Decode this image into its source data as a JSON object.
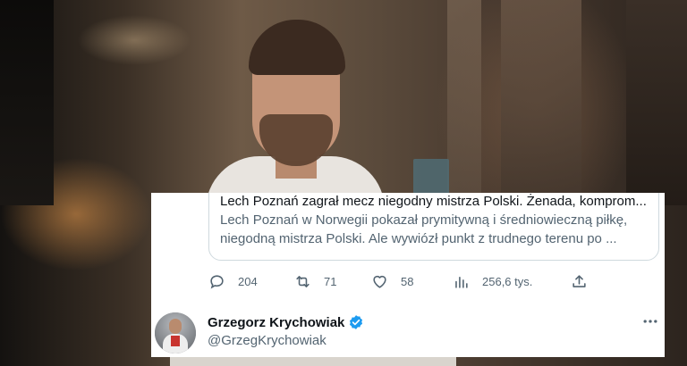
{
  "quoted_tweet": {
    "title": "Lech Poznań zagrał mecz niegodny mistrza Polski. Żenada, komprom...",
    "body_lines": [
      "Lech Poznań w Norwegii pokazał prymitywną i średniowieczną piłkę,",
      "niegodną mistrza Polski. Ale wywiózł punkt z trudnego terenu po ..."
    ]
  },
  "actions": {
    "replies": "204",
    "retweets": "71",
    "likes": "58",
    "views": "256,6 tys."
  },
  "author": {
    "name": "Grzegorz Krychowiak",
    "handle": "@GrzegKrychowiak",
    "verified": true
  },
  "colors": {
    "text_primary": "#0f1419",
    "text_secondary": "#536471",
    "verified_blue": "#1d9bf0",
    "border": "#cfd9de"
  },
  "icons": [
    "reply-icon",
    "retweet-icon",
    "like-icon",
    "views-icon",
    "share-icon",
    "verified-badge-icon",
    "more-icon"
  ]
}
